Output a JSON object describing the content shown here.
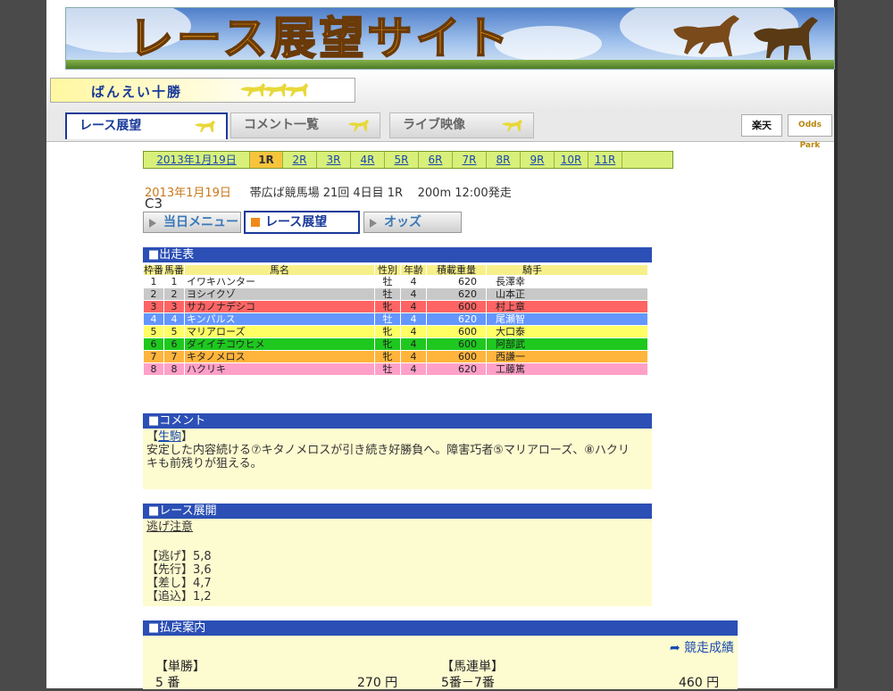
{
  "site_title": "レース展望サイト",
  "track_name": "ばんえい十勝",
  "nav": {
    "tabs": [
      "レース展望",
      "コメント一覧",
      "ライブ映像"
    ],
    "logos": [
      "楽天",
      "Odds Park"
    ]
  },
  "race_tabs": {
    "date": "2013年1月19日",
    "races": [
      "1R",
      "2R",
      "3R",
      "4R",
      "5R",
      "6R",
      "7R",
      "8R",
      "9R",
      "10R",
      "11R"
    ],
    "current": "1R"
  },
  "race_info": {
    "date": "2013年1月19日",
    "venue": "帯広ば競馬場 21回 4日目 1R",
    "distance_time": "200m 12:00発走",
    "class": "C3"
  },
  "buttons": {
    "menu": "当日メニュー",
    "preview": "レース展望",
    "odds": "オッズ"
  },
  "entries": {
    "header": "■出走表",
    "columns": {
      "waku": "枠番",
      "uma": "馬番",
      "name": "馬名",
      "sex": "性別",
      "age": "年齢",
      "weight": "積載重量",
      "jockey": "騎手"
    },
    "rows": [
      {
        "waku": "1",
        "uma": "1",
        "name": "イワキハンター",
        "sex": "牡",
        "age": "4",
        "weight": "620",
        "jockey": "長澤幸",
        "color": "#ffffff",
        "text": "#222222"
      },
      {
        "waku": "2",
        "uma": "2",
        "name": "ヨシイクゾ",
        "sex": "牡",
        "age": "4",
        "weight": "620",
        "jockey": "山本正",
        "color": "#c8c8c8",
        "text": "#222222"
      },
      {
        "waku": "3",
        "uma": "3",
        "name": "サカノナデシコ",
        "sex": "牝",
        "age": "4",
        "weight": "600",
        "jockey": "村上章",
        "color": "#ff6464",
        "text": "#222222"
      },
      {
        "waku": "4",
        "uma": "4",
        "name": "キンパルス",
        "sex": "牡",
        "age": "4",
        "weight": "620",
        "jockey": "尾瀬智",
        "color": "#6496ff",
        "text": "#ffffff"
      },
      {
        "waku": "5",
        "uma": "5",
        "name": "マリアローズ",
        "sex": "牝",
        "age": "4",
        "weight": "600",
        "jockey": "大口泰",
        "color": "#ffff64",
        "text": "#222222"
      },
      {
        "waku": "6",
        "uma": "6",
        "name": "ダイイチコウヒメ",
        "sex": "牝",
        "age": "4",
        "weight": "600",
        "jockey": "阿部武",
        "color": "#1ec81e",
        "text": "#222222"
      },
      {
        "waku": "7",
        "uma": "7",
        "name": "キタノメロス",
        "sex": "牝",
        "age": "4",
        "weight": "600",
        "jockey": "西謙一",
        "color": "#ffb43c",
        "text": "#222222"
      },
      {
        "waku": "8",
        "uma": "8",
        "name": "ハクリキ",
        "sex": "牡",
        "age": "4",
        "weight": "620",
        "jockey": "工藤篤",
        "color": "#ffa0c8",
        "text": "#222222"
      }
    ]
  },
  "comment": {
    "header": "■コメント",
    "author_open": "【",
    "author": "生駒",
    "author_close": "】",
    "text": "安定した内容続ける⑦キタノメロスが引き続き好勝負へ。障害巧者⑤マリアローズ、⑧ハクリキも前残りが狙える。"
  },
  "development": {
    "header": "■レース展開",
    "note": "逃げ注意",
    "lines": [
      "【逃げ】5,8",
      "【先行】3,6",
      "【差し】4,7",
      "【追込】1,2"
    ]
  },
  "payout": {
    "header": "■払戻案内",
    "results_link": "競走成績",
    "items": [
      {
        "type": "【単勝】",
        "combo": "5 番",
        "amount": "270 円"
      },
      {
        "type": "【馬連単】",
        "combo": "5番－7番",
        "amount": "460 円"
      }
    ]
  },
  "colors": {
    "accent_blue": "#2b4fb5",
    "race_bar": "#d8f07a",
    "current_race": "#f7c43c",
    "note_bg": "#fdfbd0",
    "orange": "#f08a18"
  }
}
